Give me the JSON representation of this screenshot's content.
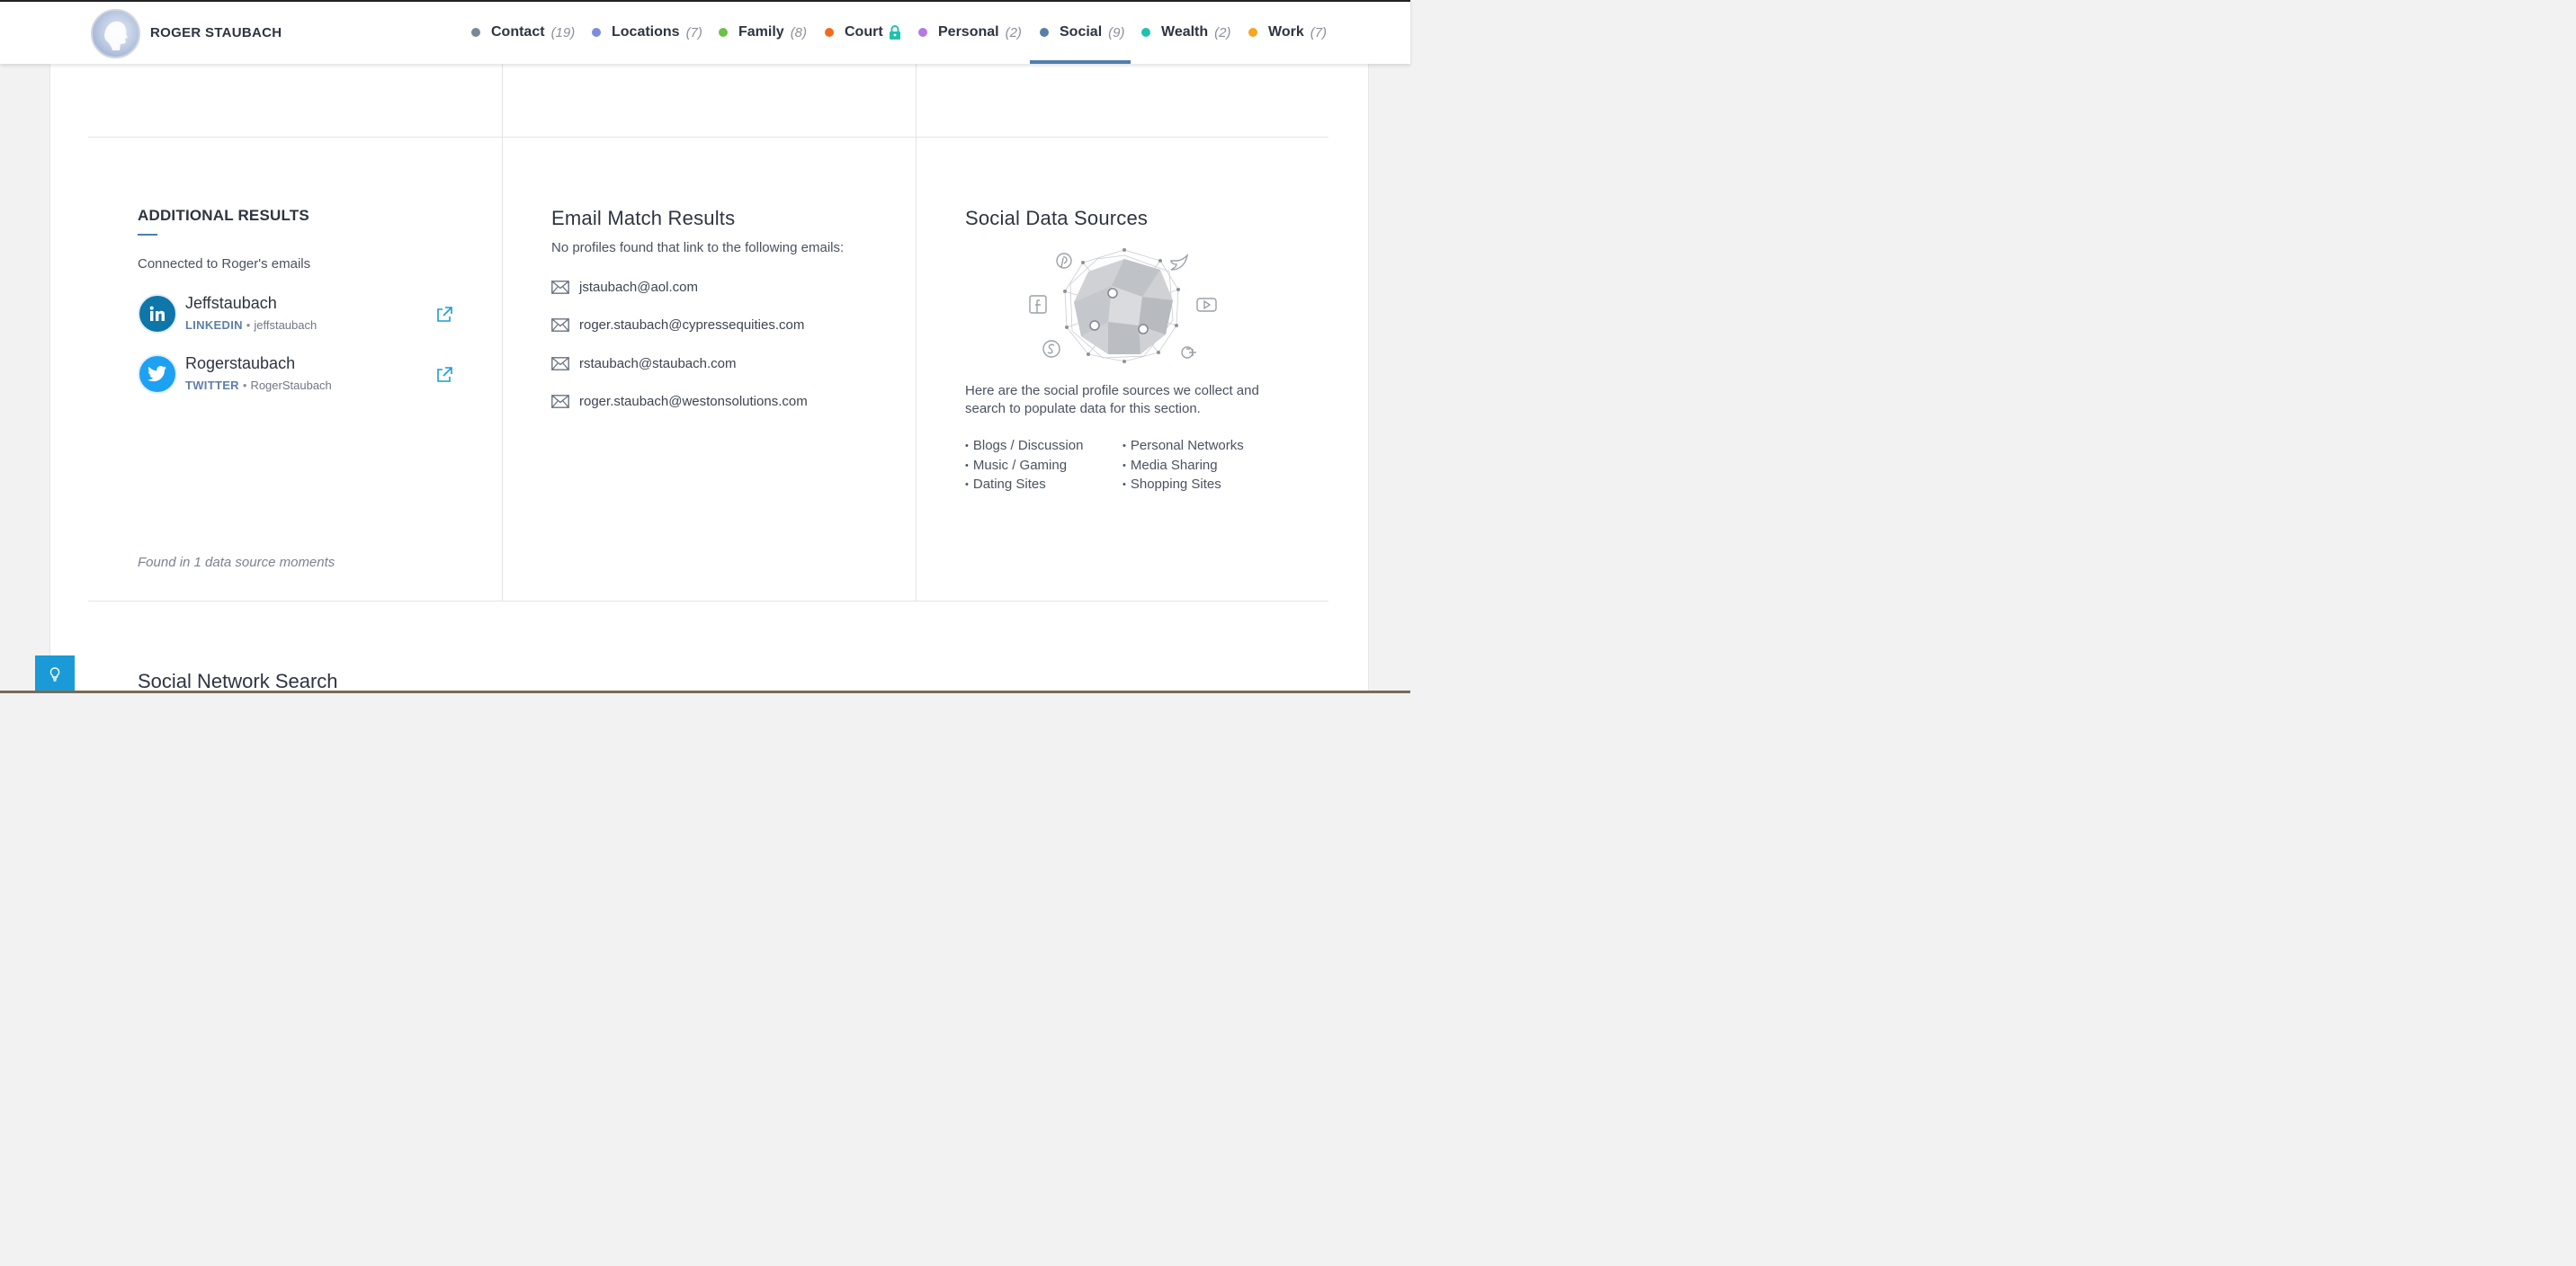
{
  "header": {
    "person_name": "ROGER STAUBACH",
    "nav": [
      {
        "label": "Contact",
        "count": "(19)",
        "color": "#7a8896"
      },
      {
        "label": "Locations",
        "count": "(7)",
        "color": "#7d8ddc"
      },
      {
        "label": "Family",
        "count": "(8)",
        "color": "#6cc04a"
      },
      {
        "label": "Court",
        "count": "",
        "color": "#f26b1d",
        "locked": true
      },
      {
        "label": "Personal",
        "count": "(2)",
        "color": "#b57ae0"
      },
      {
        "label": "Social",
        "count": "(9)",
        "color": "#5a7fa6",
        "active": true
      },
      {
        "label": "Wealth",
        "count": "(2)",
        "color": "#1fc2b0"
      },
      {
        "label": "Work",
        "count": "(7)",
        "color": "#f5a623"
      }
    ]
  },
  "additional_results": {
    "title": "ADDITIONAL RESULTS",
    "subtitle": "Connected to Roger's emails",
    "profiles": [
      {
        "name": "Jeffstaubach",
        "network": "LINKEDIN",
        "handle": "jeffstaubach",
        "icon": "linkedin-icon",
        "color": "#0e76a8"
      },
      {
        "name": "Rogerstaubach",
        "network": "TWITTER",
        "handle": "RogerStaubach",
        "icon": "twitter-icon",
        "color": "#1da1f2"
      }
    ],
    "found_note": "Found in 1 data source moments"
  },
  "email_match": {
    "title": "Email Match Results",
    "intro": "No profiles found that link to the following emails:",
    "emails": [
      "jstaubach@aol.com",
      "roger.staubach@cypressequities.com",
      "rstaubach@staubach.com",
      "roger.staubach@westonsolutions.com"
    ]
  },
  "social_sources": {
    "title": "Social Data Sources",
    "description": "Here are the social profile sources we collect and search to populate data for this section.",
    "list_left": [
      "Blogs / Discussion",
      "Music / Gaming",
      "Dating Sites"
    ],
    "list_right": [
      "Personal Networks",
      "Media Sharing",
      "Shopping Sites"
    ]
  },
  "bottom": {
    "next_section_title": "Social Network Search"
  }
}
